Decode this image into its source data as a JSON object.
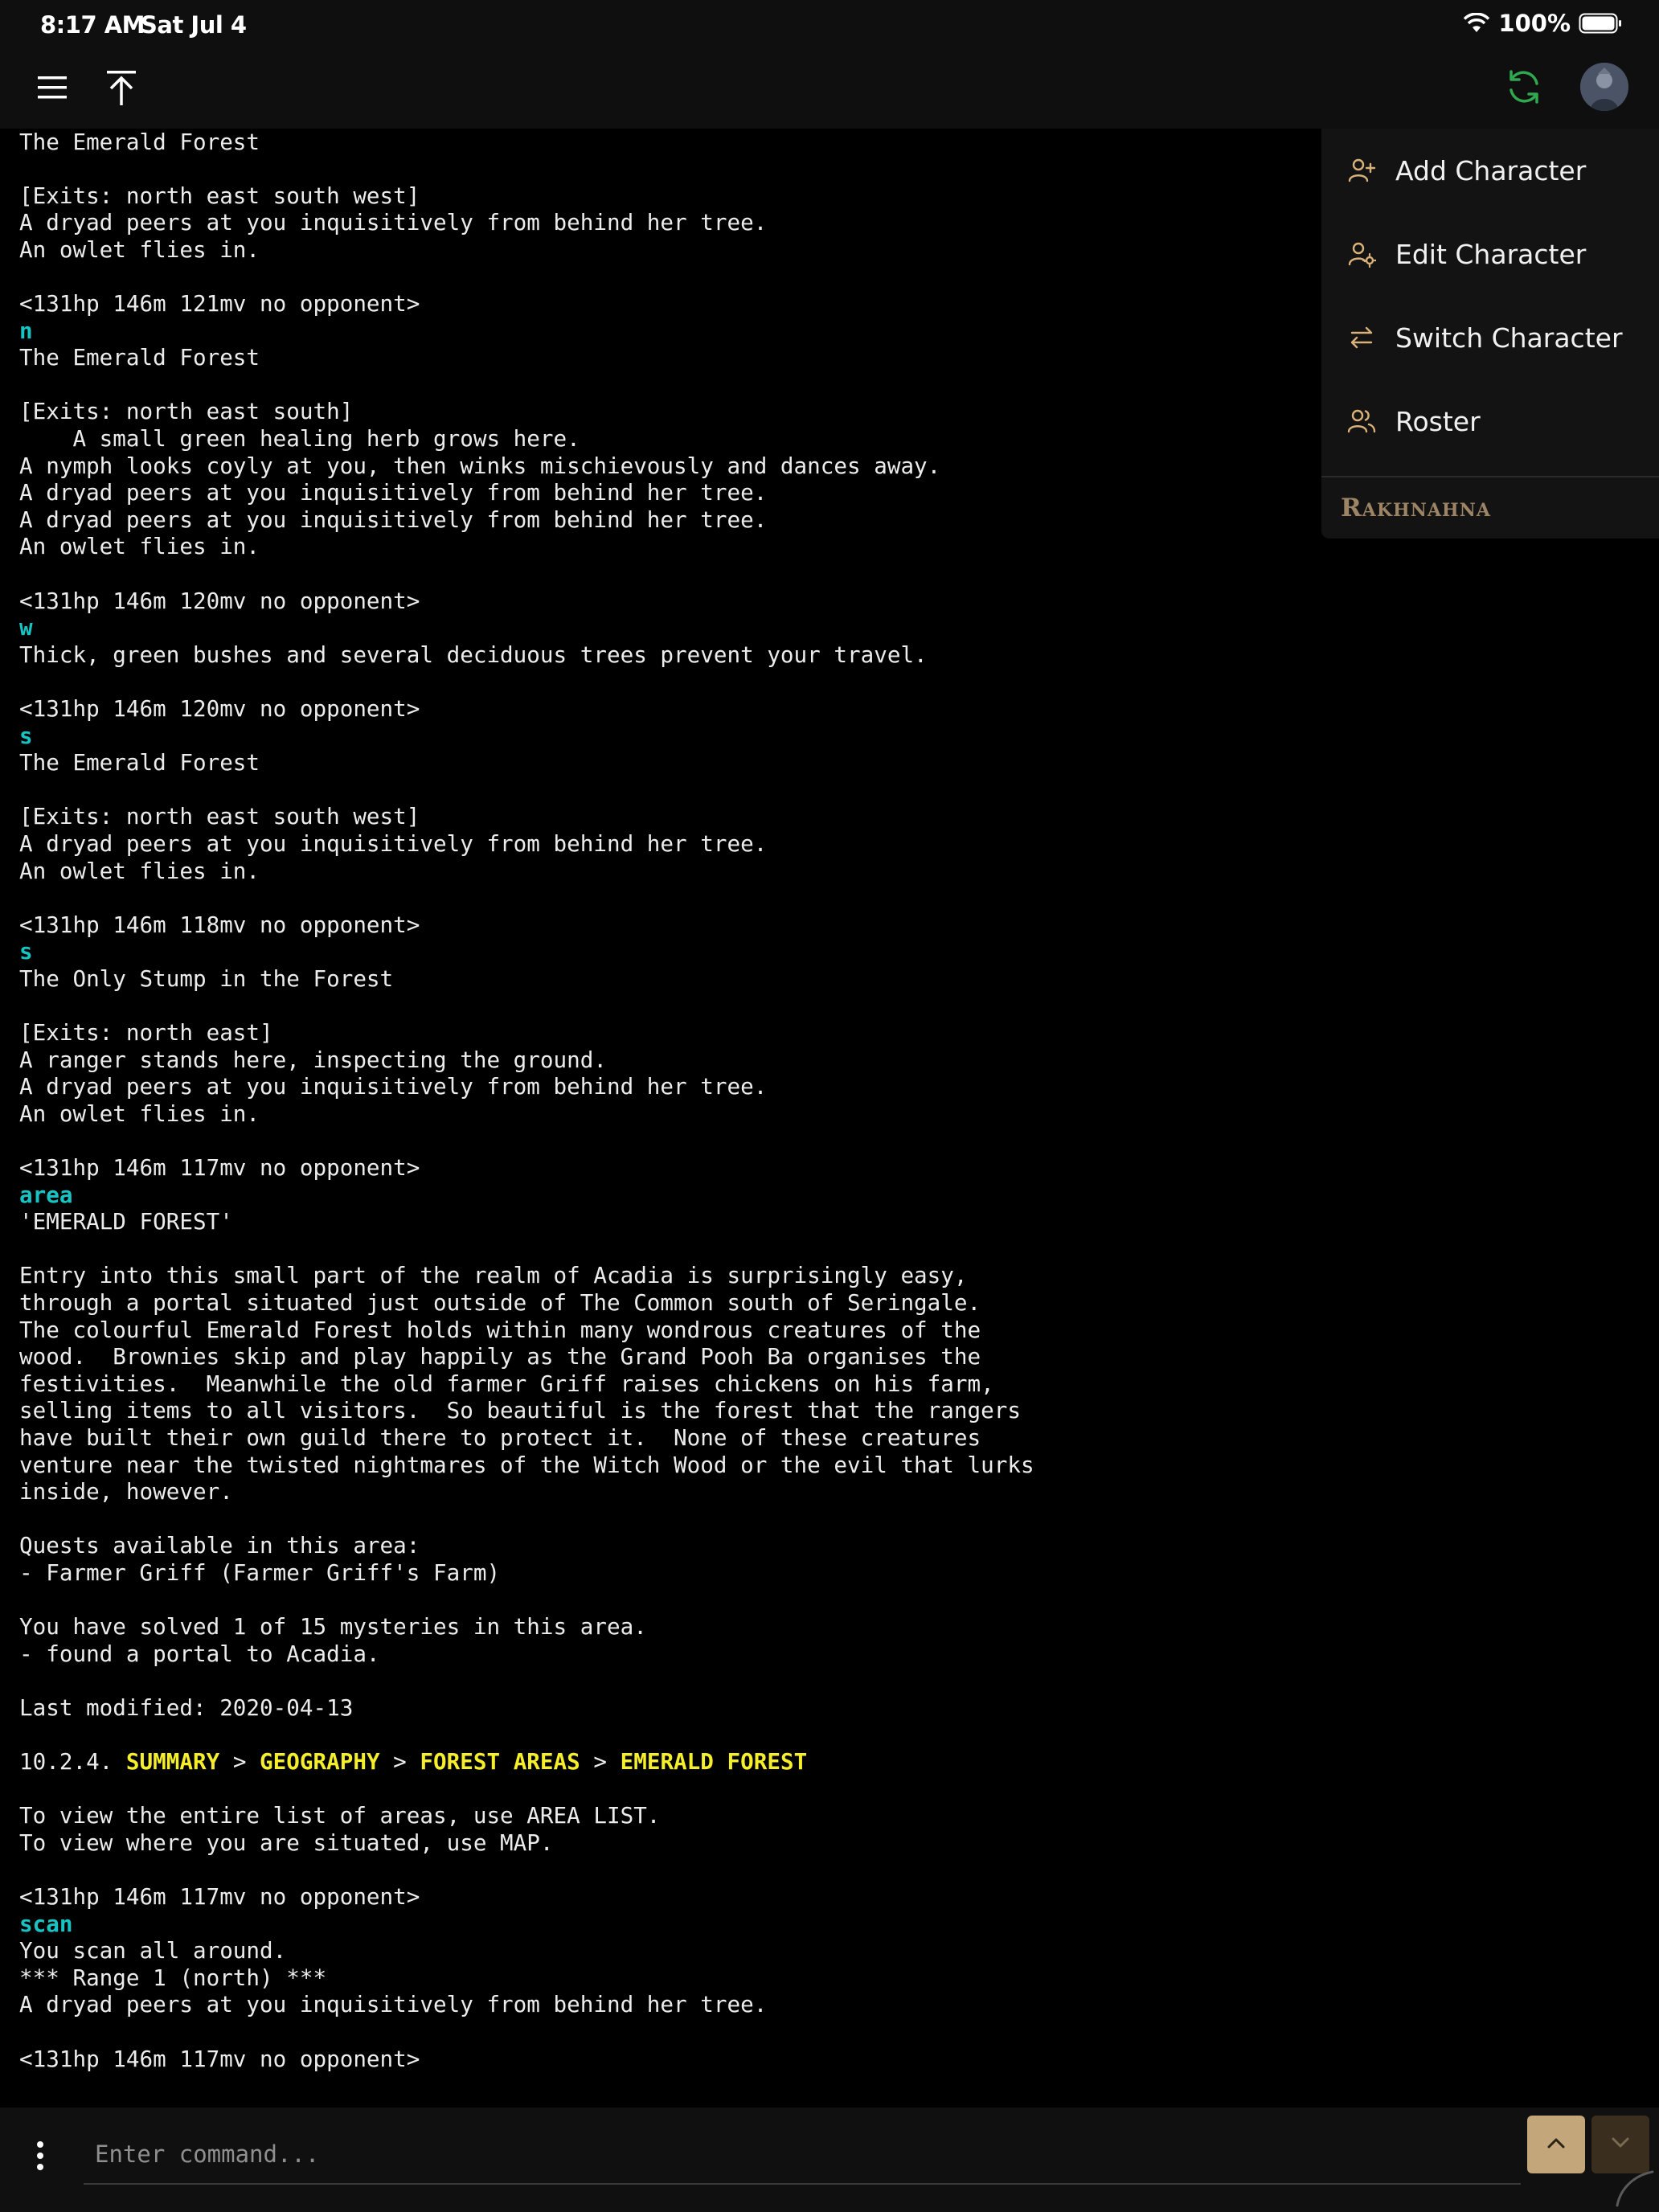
{
  "status_bar": {
    "time": "8:17 AM",
    "date": "Sat Jul 4",
    "battery": "100%"
  },
  "topbar": {
    "menu_icon": "hamburger-icon",
    "scroll_top_icon": "arrow-up-to-line-icon",
    "sync_icon": "refresh-icon",
    "sync_color": "#2fa84f",
    "avatar_icon": "character-avatar"
  },
  "dropdown": {
    "items": [
      {
        "label": "Add Character",
        "icon": "user-plus-icon"
      },
      {
        "label": "Edit Character",
        "icon": "user-gear-icon"
      },
      {
        "label": "Switch Character",
        "icon": "arrows-switch-icon"
      },
      {
        "label": "Roster",
        "icon": "users-icon"
      }
    ],
    "active_character": "Rakhnahna",
    "icon_color": "#d9b27a"
  },
  "terminal": {
    "lines": [
      {
        "t": "The Emerald Forest"
      },
      {
        "t": ""
      },
      {
        "t": "[Exits: north east south west]"
      },
      {
        "t": "A dryad peers at you inquisitively from behind her tree."
      },
      {
        "t": "An owlet flies in."
      },
      {
        "t": ""
      },
      {
        "t": "<131hp 146m 121mv no opponent>"
      },
      {
        "t": "n",
        "cmd": true
      },
      {
        "t": "The Emerald Forest"
      },
      {
        "t": ""
      },
      {
        "t": "[Exits: north east south]"
      },
      {
        "t": "    A small green healing herb grows here."
      },
      {
        "t": "A nymph looks coyly at you, then winks mischievously and dances away."
      },
      {
        "t": "A dryad peers at you inquisitively from behind her tree."
      },
      {
        "t": "A dryad peers at you inquisitively from behind her tree."
      },
      {
        "t": "An owlet flies in."
      },
      {
        "t": ""
      },
      {
        "t": "<131hp 146m 120mv no opponent>"
      },
      {
        "t": "w",
        "cmd": true
      },
      {
        "t": "Thick, green bushes and several deciduous trees prevent your travel."
      },
      {
        "t": ""
      },
      {
        "t": "<131hp 146m 120mv no opponent>"
      },
      {
        "t": "s",
        "cmd": true
      },
      {
        "t": "The Emerald Forest"
      },
      {
        "t": ""
      },
      {
        "t": "[Exits: north east south west]"
      },
      {
        "t": "A dryad peers at you inquisitively from behind her tree."
      },
      {
        "t": "An owlet flies in."
      },
      {
        "t": ""
      },
      {
        "t": "<131hp 146m 118mv no opponent>"
      },
      {
        "t": "s",
        "cmd": true
      },
      {
        "t": "The Only Stump in the Forest"
      },
      {
        "t": ""
      },
      {
        "t": "[Exits: north east]"
      },
      {
        "t": "A ranger stands here, inspecting the ground."
      },
      {
        "t": "A dryad peers at you inquisitively from behind her tree."
      },
      {
        "t": "An owlet flies in."
      },
      {
        "t": ""
      },
      {
        "t": "<131hp 146m 117mv no opponent>"
      },
      {
        "t": "area",
        "cmd": true
      },
      {
        "t": "'EMERALD FOREST'"
      },
      {
        "t": ""
      },
      {
        "t": "Entry into this small part of the realm of Acadia is surprisingly easy,"
      },
      {
        "t": "through a portal situated just outside of The Common south of Seringale."
      },
      {
        "t": "The colourful Emerald Forest holds within many wondrous creatures of the"
      },
      {
        "t": "wood.  Brownies skip and play happily as the Grand Pooh Ba organises the"
      },
      {
        "t": "festivities.  Meanwhile the old farmer Griff raises chickens on his farm,"
      },
      {
        "t": "selling items to all visitors.  So beautiful is the forest that the rangers"
      },
      {
        "t": "have built their own guild there to protect it.  None of these creatures"
      },
      {
        "t": "venture near the twisted nightmares of the Witch Wood or the evil that lurks"
      },
      {
        "t": "inside, however."
      },
      {
        "t": ""
      },
      {
        "t": "Quests available in this area:"
      },
      {
        "t": "- Farmer Griff (Farmer Griff's Farm)"
      },
      {
        "t": ""
      },
      {
        "t": "You have solved 1 of 15 mysteries in this area."
      },
      {
        "t": "- found a portal to Acadia."
      },
      {
        "t": ""
      },
      {
        "t": "Last modified: 2020-04-13"
      },
      {
        "t": ""
      },
      {
        "crumbs": true
      },
      {
        "t": ""
      },
      {
        "t": "To view the entire list of areas, use AREA LIST."
      },
      {
        "t": "To view where you are situated, use MAP."
      },
      {
        "t": ""
      },
      {
        "t": "<131hp 146m 117mv no opponent>"
      },
      {
        "t": "scan",
        "cmd": true
      },
      {
        "t": "You scan all around."
      },
      {
        "t": "*** Range 1 (north) ***"
      },
      {
        "t": "A dryad peers at you inquisitively from behind her tree."
      },
      {
        "t": ""
      },
      {
        "t": "<131hp 146m 117mv no opponent>"
      }
    ],
    "breadcrumb": {
      "prefix": "10.2.4. ",
      "parts": [
        "SUMMARY",
        "GEOGRAPHY",
        "FOREST AREAS",
        "EMERALD FOREST"
      ],
      "separator": " > "
    },
    "text_color": "#ececec",
    "command_color": "#17c3c3",
    "link_color": "#f5ee2a"
  },
  "command_bar": {
    "placeholder": "Enter command...",
    "value": "",
    "more_icon": "vertical-dots-icon",
    "up_icon": "chevron-up-icon",
    "down_icon": "chevron-down-icon",
    "accent": "#c3a679"
  }
}
